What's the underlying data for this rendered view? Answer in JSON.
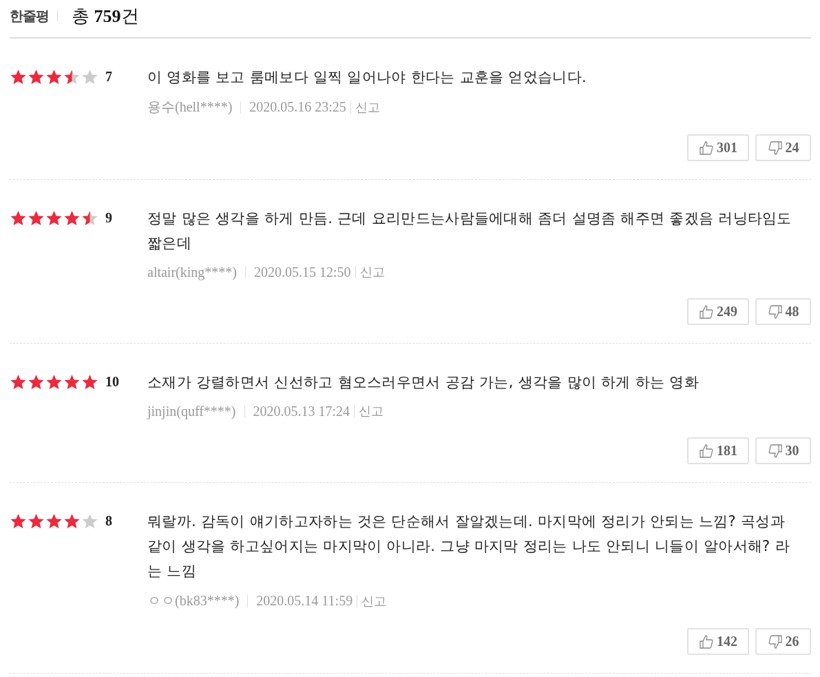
{
  "header": {
    "title": "한줄평",
    "total_prefix": "총",
    "total_count": "759",
    "total_suffix": "건"
  },
  "reviews": [
    {
      "stars": 3.5,
      "score": "7",
      "text": "이 영화를 보고 룸메보다 일찍 일어나야 한다는 교훈을 얻었습니다.",
      "author": "용수(hell****)",
      "date": "2020.05.16 23:25",
      "report": "신고",
      "likes": "301",
      "dislikes": "24"
    },
    {
      "stars": 4.5,
      "score": "9",
      "text": "정말 많은 생각을 하게 만듬. 근데 요리만드는사람들에대해 좀더 설명좀 해주면 좋겠음 러닝타임도 짧은데",
      "author": "altair(king****)",
      "date": "2020.05.15 12:50",
      "report": "신고",
      "likes": "249",
      "dislikes": "48"
    },
    {
      "stars": 5,
      "score": "10",
      "text": "소재가 강렬하면서 신선하고 혐오스러우면서 공감 가는, 생각을 많이 하게 하는 영화",
      "author": "jinjin(quff****)",
      "date": "2020.05.13 17:24",
      "report": "신고",
      "likes": "181",
      "dislikes": "30"
    },
    {
      "stars": 4,
      "score": "8",
      "text": "뭐랄까. 감독이 얘기하고자하는 것은 단순해서 잘알겠는데. 마지막에 정리가 안되는 느낌? 곡성과 같이 생각을 하고싶어지는 마지막이 아니라. 그냥 마지막 정리는 나도 안되니 니들이 알아서해? 라는 느낌",
      "author": "ㅇㅇ(bk83****)",
      "date": "2020.05.14 11:59",
      "report": "신고",
      "likes": "142",
      "dislikes": "26"
    }
  ]
}
